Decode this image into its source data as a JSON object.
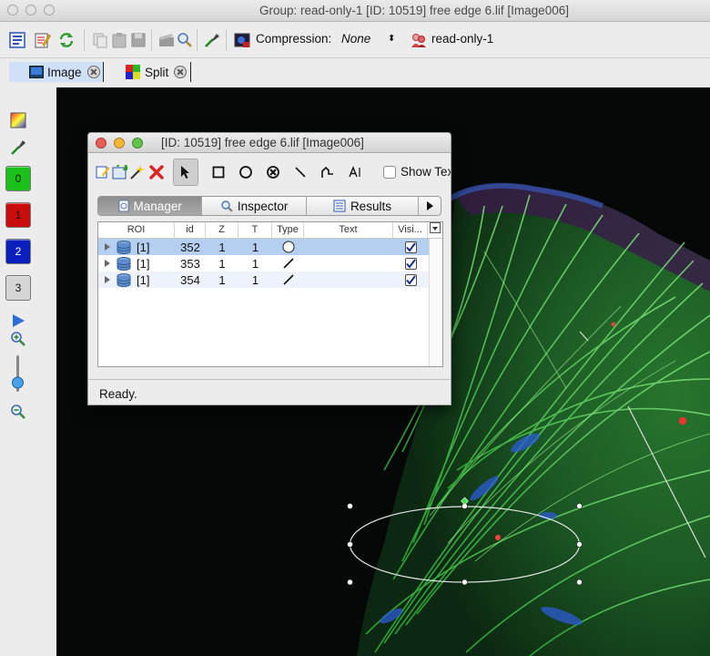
{
  "window": {
    "title": "Group: read-only-1 [ID: 10519] free edge 6.lif [Image006]"
  },
  "toolbar": {
    "compression_label": "Compression:",
    "compression_value": "None",
    "group_label": "read-only-1"
  },
  "tabs": [
    {
      "label": "Image",
      "active": true
    },
    {
      "label": "Split",
      "active": false
    }
  ],
  "channels": [
    {
      "label": "0",
      "color": "#19c119"
    },
    {
      "label": "1",
      "color": "#c90c0c"
    },
    {
      "label": "2",
      "color": "#0b1fbd"
    },
    {
      "label": "3",
      "color": "#d6d6d6"
    }
  ],
  "roi_dialog": {
    "title": "[ID: 10519] free edge 6.lif [Image006]",
    "show_text_label": "Show Text",
    "show_text_checked": false,
    "subtabs": [
      {
        "label": "Manager",
        "active": true
      },
      {
        "label": "Inspector",
        "active": false
      },
      {
        "label": "Results",
        "active": false
      }
    ],
    "columns": [
      "ROI",
      "id",
      "Z",
      "T",
      "Type",
      "Text",
      "Visi..."
    ],
    "rows": [
      {
        "roi": "[1]",
        "id": "352",
        "z": "1",
        "t": "1",
        "type": "ellipse",
        "text": "",
        "visible": true
      },
      {
        "roi": "[1]",
        "id": "353",
        "z": "1",
        "t": "1",
        "type": "line",
        "text": "",
        "visible": true
      },
      {
        "roi": "[1]",
        "id": "354",
        "z": "1",
        "t": "1",
        "type": "line",
        "text": "",
        "visible": true
      }
    ],
    "status": "Ready."
  }
}
